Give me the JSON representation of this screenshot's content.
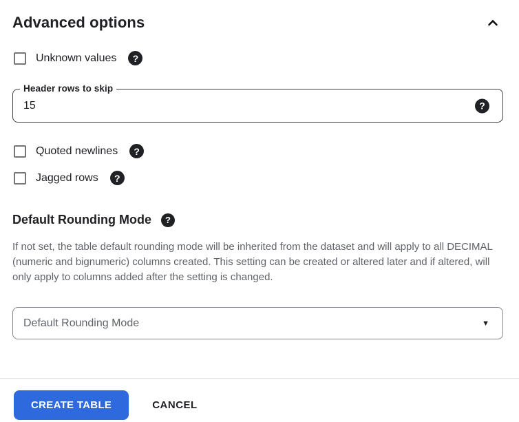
{
  "panel": {
    "title": "Advanced options",
    "collapse_icon": "chevron-up"
  },
  "checkboxes": [
    {
      "label": "Unknown values",
      "checked": false
    },
    {
      "label": "Quoted newlines",
      "checked": false
    },
    {
      "label": "Jagged rows",
      "checked": false
    }
  ],
  "fields": {
    "header_rows_to_skip": {
      "label": "Header rows to skip",
      "value": "15"
    },
    "rounding_select": {
      "value": "Default Rounding Mode"
    }
  },
  "rounding_section": {
    "heading": "Default Rounding Mode",
    "description": "If not set, the table default rounding mode will be inherited from the dataset and will apply to all DECIMAL (numeric and bignumeric) columns created. This setting can be created or altered later and if altered, will only apply to columns added after the setting is changed."
  },
  "glyphs": {
    "help": "?",
    "caret": "▼"
  },
  "footer": {
    "create_label": "CREATE TABLE",
    "cancel_label": "CANCEL"
  },
  "colors": {
    "primary_button": "#2e69de",
    "text_primary": "#202124",
    "text_secondary": "#5f6368",
    "checkbox_border": "#757575",
    "field_border": "#3c4043",
    "select_border": "#80868b",
    "divider": "#e0e0e0",
    "help_icon_bg": "#202124"
  }
}
